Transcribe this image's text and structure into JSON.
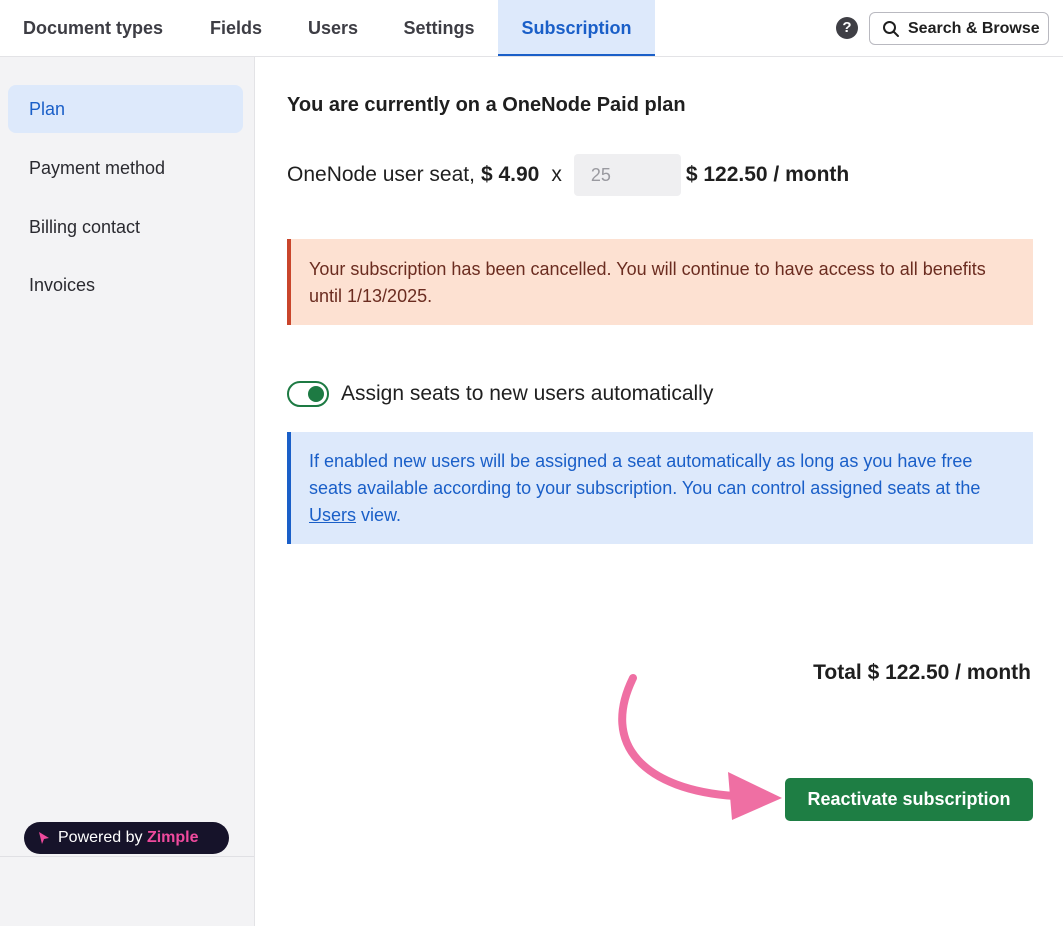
{
  "nav": {
    "tabs": [
      {
        "label": "Document types"
      },
      {
        "label": "Fields"
      },
      {
        "label": "Users"
      },
      {
        "label": "Settings"
      },
      {
        "label": "Subscription"
      }
    ],
    "active_tab": "Subscription",
    "help_icon": "?",
    "search_label": "Search & Browse"
  },
  "sidebar": {
    "items": [
      {
        "label": "Plan"
      },
      {
        "label": "Payment method"
      },
      {
        "label": "Billing contact"
      },
      {
        "label": "Invoices"
      }
    ],
    "active_item": "Plan",
    "powered_by": "Powered by",
    "brand": "Zimple"
  },
  "plan": {
    "title": "You are currently on a OneNode Paid plan",
    "seat_label": "OneNode user seat,",
    "seat_price": "$ 4.90",
    "multiplier": "x",
    "seat_count": "25",
    "seat_total": "$ 122.50 / month"
  },
  "cancel_notice": {
    "text": "Your subscription has been cancelled. You will continue to have access to all benefits until 1/13/2025."
  },
  "auto_assign": {
    "label": "Assign seats to new users automatically",
    "enabled": true
  },
  "info_notice": {
    "text_before": "If enabled new users will be assigned a seat automatically as long as you have free seats available according to your subscription. You can control assigned seats at the ",
    "link": "Users",
    "text_after": " view."
  },
  "total": "Total $ 122.50 / month",
  "reactivate_label": "Reactivate subscription",
  "colors": {
    "accent": "#1a5fc8",
    "accent_bg": "#dde9fb",
    "success": "#1e7e44",
    "warning_bg": "#fde1d2",
    "warning_border": "#c9452b",
    "annotation_arrow": "#ef6fa3"
  }
}
